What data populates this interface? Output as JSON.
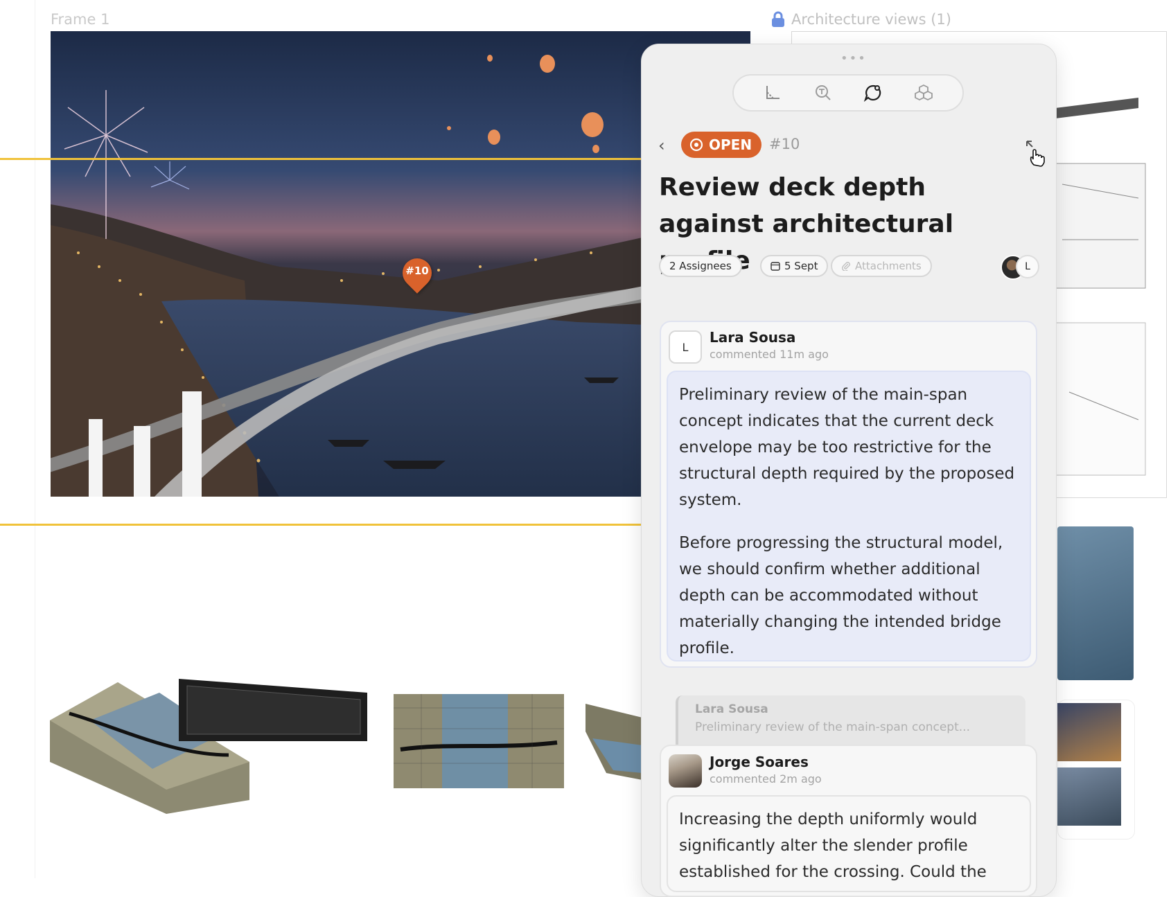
{
  "canvas": {
    "frame1_label": "Frame 1",
    "architecture_views_label": "Architecture views (1)",
    "pin_label": "#10"
  },
  "panel": {
    "toolbar": {
      "tools": [
        "measure-tool",
        "inspect-tool",
        "comments-tool",
        "components-tool"
      ],
      "active": "comments-tool"
    },
    "issue": {
      "status": "OPEN",
      "number": "#10",
      "title": "Review deck depth against architectural profile",
      "assignees_label": "2 Assignees",
      "due_label": "5 Sept",
      "attachments_label": "Attachments",
      "avatar_letter": "L"
    },
    "comments": [
      {
        "author": "Lara Sousa",
        "avatar_letter": "L",
        "meta": "commented 11m ago",
        "paragraphs": [
          "Preliminary review of the main-span concept indicates that the current deck envelope may be too restrictive for the structural depth required by the proposed system.",
          "Before progressing the structural model, we should confirm whether additional depth can be accommodated without materially changing the intended bridge profile."
        ]
      },
      {
        "author": "Jorge Soares",
        "meta": "commented 2m ago",
        "reply_to_author": "Lara Sousa",
        "reply_to_excerpt": "Preliminary review of the main-span concept...",
        "paragraphs": [
          "Increasing the depth uniformly would significantly alter the slender profile established for the crossing. Could the"
        ]
      }
    ]
  },
  "colors": {
    "accent_open": "#d9622b",
    "selection_yellow": "#f0c23a",
    "comment_bg": "#e8ebf8"
  }
}
